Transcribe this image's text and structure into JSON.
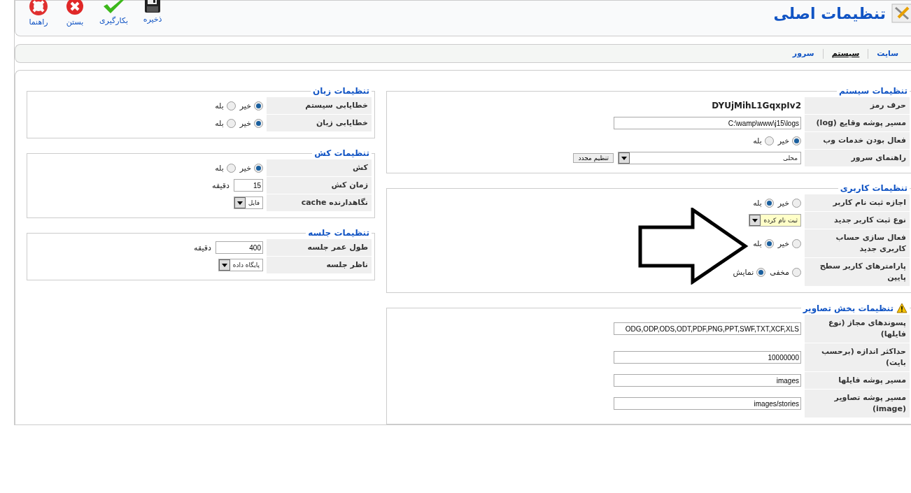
{
  "toolbar": {
    "title": "تنظیمات اصلی",
    "buttons": [
      {
        "label": "ذخیره",
        "kind": "save"
      },
      {
        "label": "بکارگیری",
        "kind": "apply"
      },
      {
        "label": "بستن",
        "kind": "close"
      },
      {
        "label": "راهنما",
        "kind": "help"
      }
    ]
  },
  "tabs": [
    {
      "label": "سایت",
      "selected": false
    },
    {
      "label": "سیستم",
      "selected": true
    },
    {
      "label": "سرور",
      "selected": false
    }
  ],
  "right_column": {
    "sections": [
      {
        "title": "تنظیمات سیستم",
        "warning": false,
        "rows": [
          {
            "label": "حرف رمز",
            "kind": "text",
            "value": "DYUjMihL1GqxpIv2"
          },
          {
            "label": "مسیر پوشه وقایع (log)",
            "kind": "input",
            "value": "C:\\wamp\\www\\j15\\logs"
          },
          {
            "label": "فعال بودن خدمات وب",
            "kind": "radio",
            "options": [
              {
                "label": "خیر",
                "selected": true
              },
              {
                "label": "بله",
                "selected": false
              }
            ]
          },
          {
            "label": "راهنمای سرور",
            "kind": "select",
            "value": "محلی",
            "button": "تنظیم مجدد",
            "highlighted": false
          }
        ]
      },
      {
        "title": "تنظیمات کاربری",
        "warning": false,
        "rows": [
          {
            "label": "اجازه ثبت نام کاربر",
            "kind": "radio",
            "options": [
              {
                "label": "خیر",
                "selected": false
              },
              {
                "label": "بله",
                "selected": true
              }
            ]
          },
          {
            "label": "نوع ثبت کاربر جدید",
            "kind": "select",
            "value": "ثبت نام کرده",
            "highlighted": true
          },
          {
            "label": "فعال سازی حساب کاربری جدید",
            "kind": "radio",
            "options": [
              {
                "label": "خیر",
                "selected": false
              },
              {
                "label": "بله",
                "selected": true
              }
            ]
          },
          {
            "label": "پارامترهای کاربر سطح پایین",
            "kind": "radio",
            "options": [
              {
                "label": "مخفی",
                "selected": false
              },
              {
                "label": "نمایش",
                "selected": true
              }
            ]
          }
        ]
      },
      {
        "title": "تنظیمات بخش تصاویر",
        "warning": true,
        "rows": [
          {
            "label": "پسوندهای مجاز (نوع فایلها)",
            "kind": "input",
            "value": "ODG,ODP,ODS,ODT,PDF,PNG,PPT,SWF,TXT,XCF,XLS"
          },
          {
            "label": "حداکثر اندازه (برحسب بایت)",
            "kind": "input",
            "value": "10000000"
          },
          {
            "label": "مسیر پوشه فایلها",
            "kind": "input",
            "value": "images"
          },
          {
            "label": "مسیر پوشه تصاویر (image)",
            "kind": "input",
            "value": "images/stories"
          }
        ]
      }
    ]
  },
  "left_column": {
    "sections": [
      {
        "title": "تنظیمات زبان",
        "warning": false,
        "rows": [
          {
            "label": "خطایابی سیستم",
            "kind": "radio",
            "options": [
              {
                "label": "خیر",
                "selected": true
              },
              {
                "label": "بله",
                "selected": false
              }
            ]
          },
          {
            "label": "خطایابی زبان",
            "kind": "radio",
            "options": [
              {
                "label": "خیر",
                "selected": true
              },
              {
                "label": "بله",
                "selected": false
              }
            ]
          }
        ]
      },
      {
        "title": "تنظیمات کش",
        "warning": false,
        "rows": [
          {
            "label": "کش",
            "kind": "radio",
            "options": [
              {
                "label": "خیر",
                "selected": true
              },
              {
                "label": "بله",
                "selected": false
              }
            ]
          },
          {
            "label": "زمان کش",
            "kind": "input",
            "value": "15",
            "unit": "دقیقه"
          },
          {
            "label": "نگاهدارنده cache",
            "kind": "select",
            "value": "فایل",
            "highlighted": false
          }
        ]
      },
      {
        "title": "تنظیمات جلسه",
        "warning": false,
        "rows": [
          {
            "label": "طول عمر جلسه",
            "kind": "input",
            "value": "400",
            "unit": "دقیقه"
          },
          {
            "label": "ناظر جلسه",
            "kind": "select",
            "value": "پایگاه داده",
            "highlighted": false
          }
        ]
      }
    ]
  },
  "annotation": {
    "kind": "arrow"
  }
}
